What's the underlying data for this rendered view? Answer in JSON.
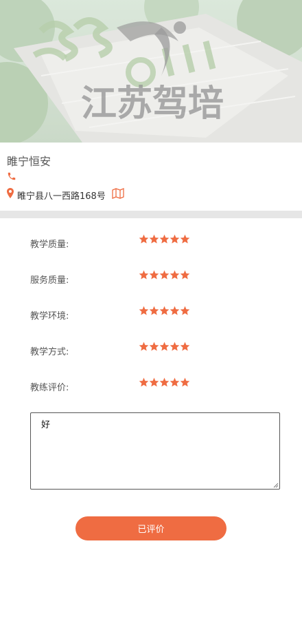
{
  "banner": {
    "watermark_text": "江苏驾培",
    "image": "training-ground-aerial-photo"
  },
  "school": {
    "name": "睢宁恒安",
    "phone": "",
    "address": "睢宁县八一西路168号"
  },
  "ratings": [
    {
      "label": "教学质量:",
      "stars": 5
    },
    {
      "label": "服务质量:",
      "stars": 5
    },
    {
      "label": "教学环境:",
      "stars": 5
    },
    {
      "label": "教学方式:",
      "stars": 5
    },
    {
      "label": "教练评价:",
      "stars": 5
    }
  ],
  "comment": {
    "value": "好"
  },
  "submit": {
    "label": "已评价"
  },
  "colors": {
    "accent": "#ef6c42",
    "divider": "#e6e6e6"
  },
  "icons": [
    "phone-icon",
    "location-pin-icon",
    "map-icon",
    "star-icon"
  ]
}
